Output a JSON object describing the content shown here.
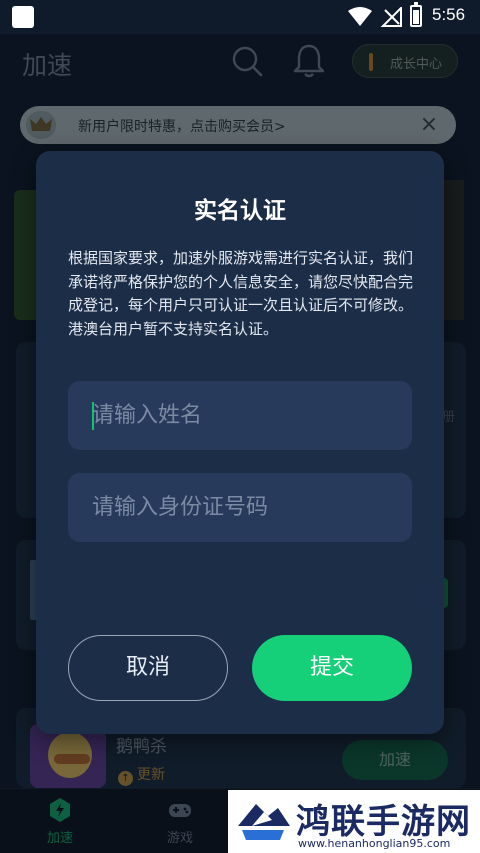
{
  "status_bar": {
    "time": "5:56"
  },
  "header": {
    "title": "加速",
    "growth_center_label": "成长中心"
  },
  "promo_banner": {
    "text": "新用户限时特惠，点击购买会员>",
    "close_glyph": "×"
  },
  "background": {
    "edge_text": "册",
    "game": {
      "name": "鹅鸭杀",
      "update_label": "更新",
      "accelerate_label": "加速"
    }
  },
  "bottom_nav": {
    "items": [
      {
        "label": "加速",
        "icon": "rocket-icon",
        "active": true
      },
      {
        "label": "游戏",
        "icon": "gamepad-icon",
        "active": false
      }
    ]
  },
  "watermark": {
    "title": "鸿联手游网",
    "url": "www.henanhonglian95.com"
  },
  "dialog": {
    "title": "实名认证",
    "description": "根据国家要求，加速外服游戏需进行实名认证，我们承诺将严格保护您的个人信息安全，请您尽快配合完成登记，每个用户只可认证一次且认证后不可修改。港澳台用户暂不支持实名认证。",
    "name_placeholder": "请输入姓名",
    "id_placeholder": "请输入身份证号码",
    "cancel_label": "取消",
    "submit_label": "提交"
  },
  "colors": {
    "accent_green": "#16cf79",
    "dialog_bg": "#1c2d48",
    "field_bg": "#273a5c"
  }
}
